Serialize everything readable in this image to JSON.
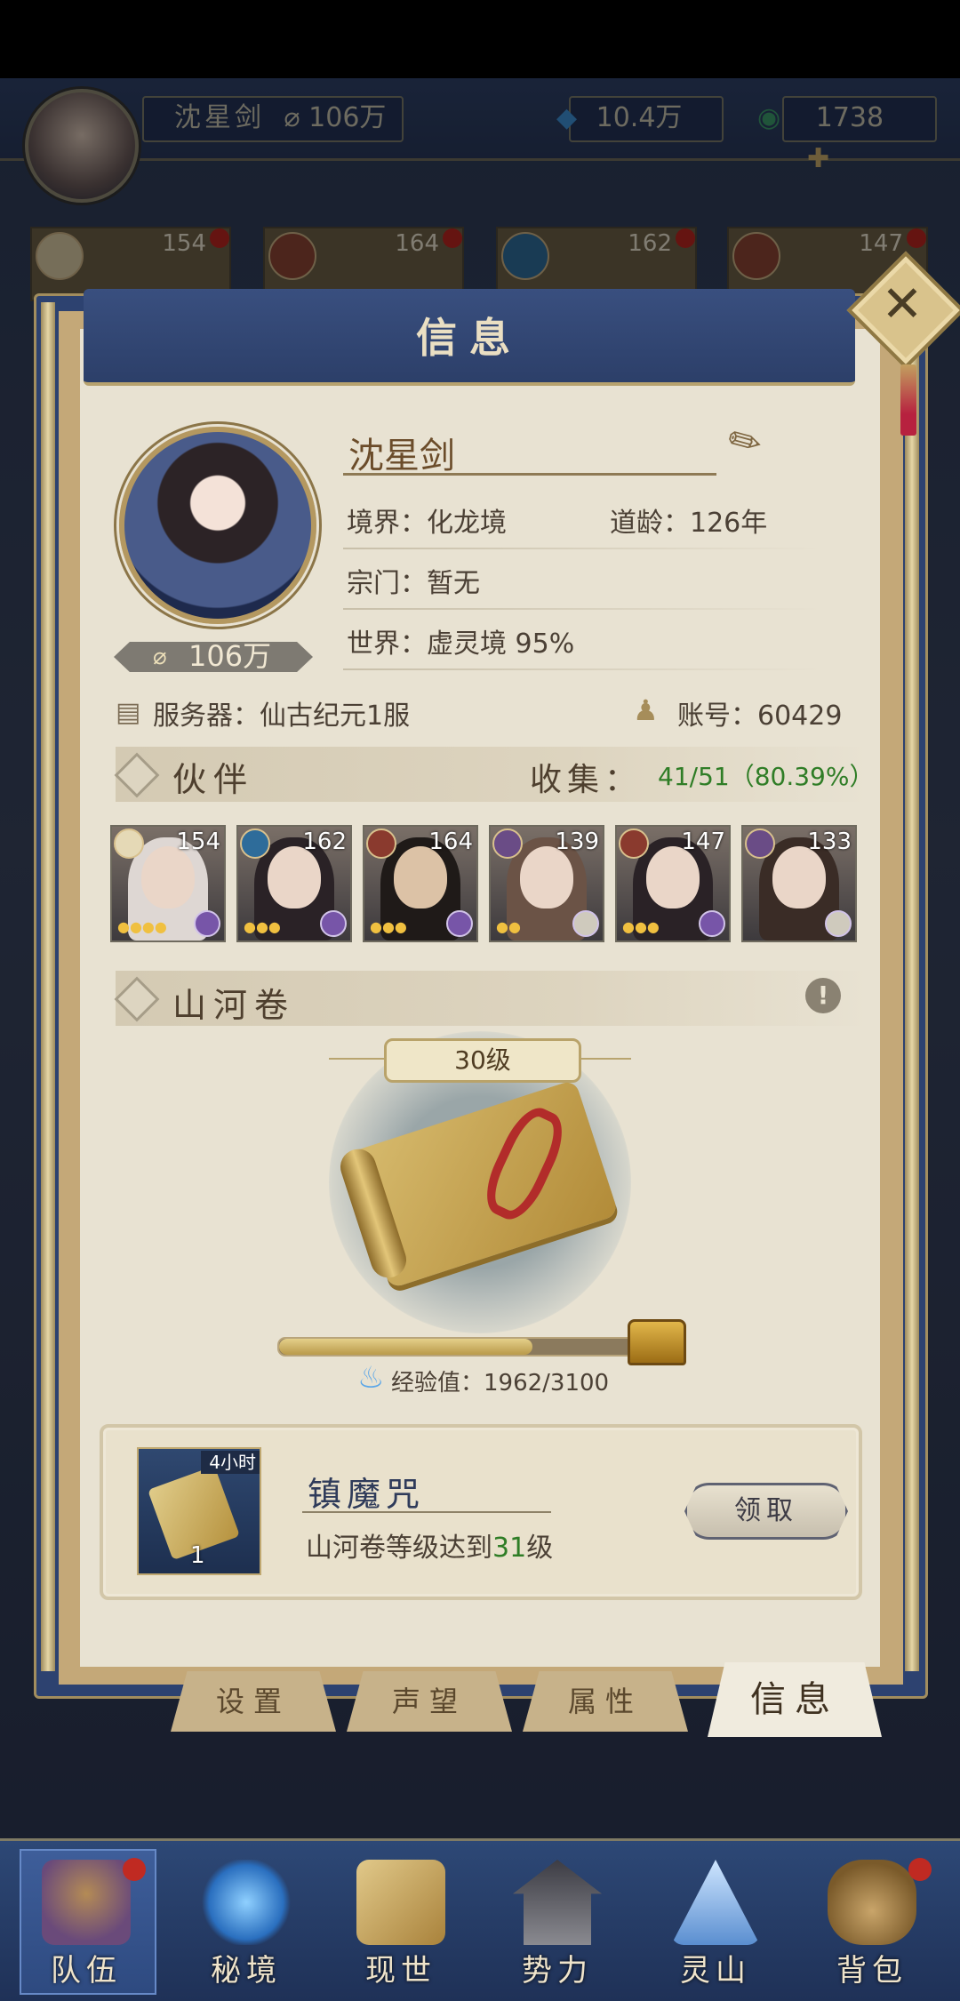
{
  "header": {
    "player_name": "沈星剑",
    "power": "106万",
    "currency1": "10.4万",
    "currency2": "1738"
  },
  "background_slots": [
    "154",
    "164",
    "162",
    "147"
  ],
  "modal": {
    "title": "信息",
    "player_name": "沈星剑",
    "power": "106万",
    "realm": "境界：化龙境",
    "age": "道龄：126年",
    "sect": "宗门：暂无",
    "world": "世界：虚灵境  95%",
    "server": "服务器：仙古纪元1服",
    "account": "账号：60429"
  },
  "companions": {
    "title": "伙伴",
    "collect_label": "收集：",
    "collect_value": "41/51（80.39%）",
    "cards": [
      {
        "level": "154",
        "stars": "●●●●"
      },
      {
        "level": "162",
        "stars": "●●●"
      },
      {
        "level": "164",
        "stars": "●●●"
      },
      {
        "level": "139",
        "stars": "●●"
      },
      {
        "level": "147",
        "stars": "●●●"
      },
      {
        "level": "133",
        "stars": ""
      }
    ]
  },
  "scroll": {
    "title": "山河卷",
    "info": "!",
    "level": "30级",
    "exp_label": "经验值：1962/3100",
    "exp_current": 1962,
    "exp_max": 3100
  },
  "quest": {
    "time": "4小时",
    "count": "1",
    "title": "镇魔咒",
    "desc_prefix": "山河卷等级达到",
    "desc_highlight": "31",
    "desc_suffix": "级",
    "claim_label": "领取"
  },
  "tabs": [
    "设置",
    "声望",
    "属性",
    "信息"
  ],
  "nav": [
    "队伍",
    "秘境",
    "现世",
    "势力",
    "灵山",
    "背包"
  ],
  "colors": {
    "accent_green": "#2f7d26",
    "badge_red": "#c02a22",
    "nav_blue": "#2d4876"
  }
}
